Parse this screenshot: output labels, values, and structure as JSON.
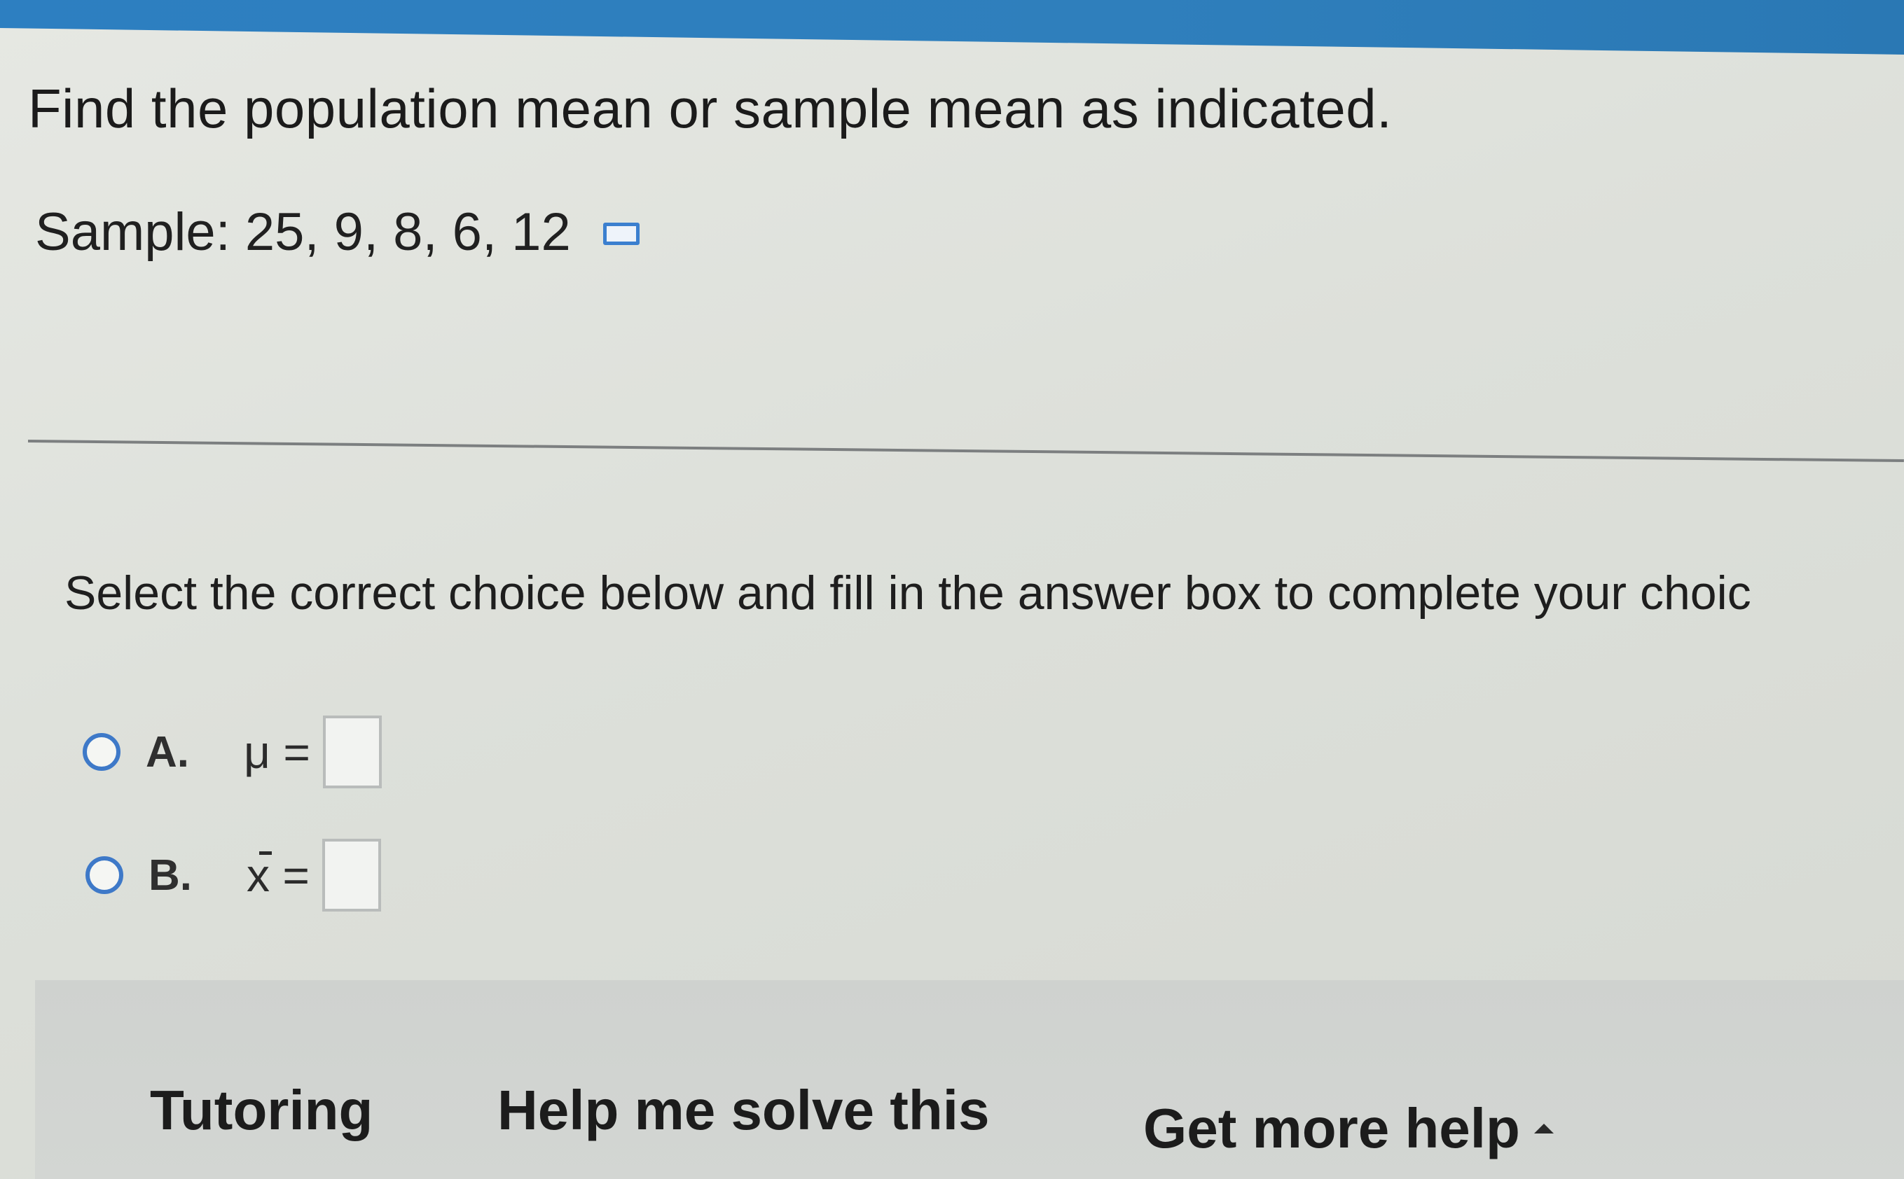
{
  "question": {
    "title": "Find the population mean or sample mean as indicated.",
    "sample_text": "Sample: 25, 9, 8, 6, 12",
    "data_icon": "data-table-icon"
  },
  "instructions": "Select the correct choice below and fill in the answer box to complete your choic",
  "choices": [
    {
      "letter": "A.",
      "symbol": "μ",
      "equals": "=",
      "value": ""
    },
    {
      "letter": "B.",
      "symbol": "x",
      "equals": "=",
      "value": ""
    }
  ],
  "help_bar": {
    "tutoring": "Tutoring",
    "solve": "Help me solve this",
    "more_help": "Get more help",
    "more_help_icon": "caret-up-icon"
  },
  "colors": {
    "accent": "#3e79c8",
    "top_bar": "#2d7fc1"
  }
}
